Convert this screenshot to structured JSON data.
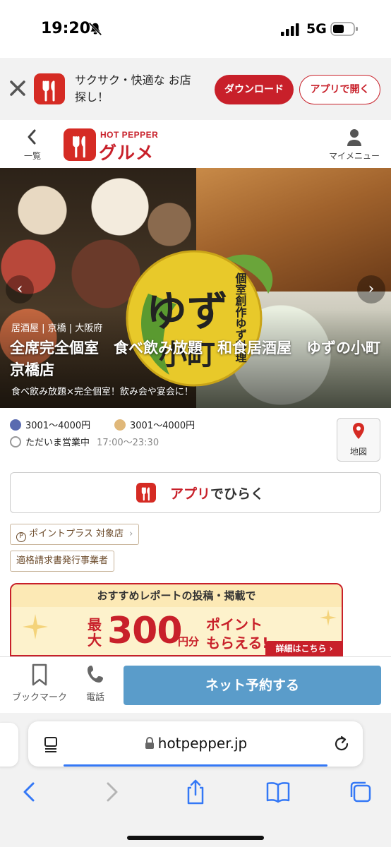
{
  "status_bar": {
    "time": "19:20",
    "network": "5G"
  },
  "app_banner": {
    "text": "サクサク・快適な お店探し！",
    "download_label": "ダウンロード",
    "open_label": "アプリで開く"
  },
  "site_header": {
    "back_label": "一覧",
    "logo_top": "HOT PEPPER",
    "logo_main": "グルメ",
    "menu_label": "マイメニュー"
  },
  "hero": {
    "category": "居酒屋 | 京橋 | 大阪府",
    "title": "全席完全個室　食べ飲み放題　和食居酒屋　ゆずの小町　京橋店",
    "subtitle": "食べ飲み放題×完全個室！飲み会や宴会に！",
    "logo_text_main": "ゆずの小町",
    "logo_text_side": "個室創作ゆず料理"
  },
  "info": {
    "dinner_budget": "3001～4000円",
    "lunch_budget": "3001～4000円",
    "status": "ただいま営業中",
    "hours": "17:00～23:30",
    "map_label": "地図"
  },
  "open_app": {
    "red": "アプリ",
    "rest": "でひらく"
  },
  "tags": {
    "point_plus": "ポイントプラス 対象店",
    "invoice": "適格請求書発行事業者"
  },
  "report_banner": {
    "headline": "おすすめレポートの投稿・掲載で",
    "max": "最大",
    "amount": "300",
    "unit": "円分",
    "point": "ポイント",
    "get": "もらえる!",
    "detail": "詳細はこちら ›"
  },
  "action_bar": {
    "bookmark_label": "ブックマーク",
    "phone_label": "電話",
    "reserve_label": "ネット予約する"
  },
  "browser": {
    "url": "hotpepper.jp"
  },
  "colors": {
    "brand_red": "#c8202a",
    "reserve_blue": "#5a9cca",
    "safari_blue": "#3478f6"
  }
}
